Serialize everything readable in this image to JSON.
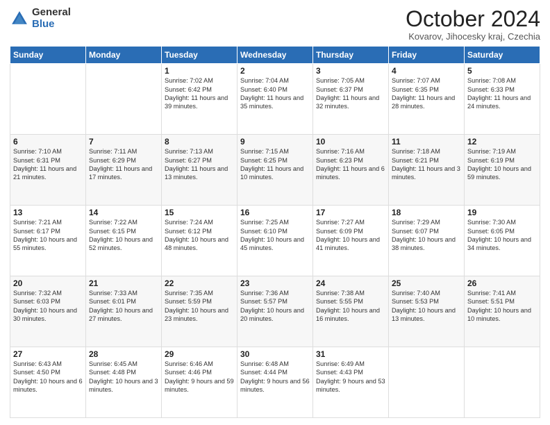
{
  "header": {
    "logo_general": "General",
    "logo_blue": "Blue",
    "month_title": "October 2024",
    "location": "Kovarov, Jihocesky kraj, Czechia"
  },
  "days_of_week": [
    "Sunday",
    "Monday",
    "Tuesday",
    "Wednesday",
    "Thursday",
    "Friday",
    "Saturday"
  ],
  "weeks": [
    [
      {
        "day": "",
        "text": ""
      },
      {
        "day": "",
        "text": ""
      },
      {
        "day": "1",
        "text": "Sunrise: 7:02 AM\nSunset: 6:42 PM\nDaylight: 11 hours and 39 minutes."
      },
      {
        "day": "2",
        "text": "Sunrise: 7:04 AM\nSunset: 6:40 PM\nDaylight: 11 hours and 35 minutes."
      },
      {
        "day": "3",
        "text": "Sunrise: 7:05 AM\nSunset: 6:37 PM\nDaylight: 11 hours and 32 minutes."
      },
      {
        "day": "4",
        "text": "Sunrise: 7:07 AM\nSunset: 6:35 PM\nDaylight: 11 hours and 28 minutes."
      },
      {
        "day": "5",
        "text": "Sunrise: 7:08 AM\nSunset: 6:33 PM\nDaylight: 11 hours and 24 minutes."
      }
    ],
    [
      {
        "day": "6",
        "text": "Sunrise: 7:10 AM\nSunset: 6:31 PM\nDaylight: 11 hours and 21 minutes."
      },
      {
        "day": "7",
        "text": "Sunrise: 7:11 AM\nSunset: 6:29 PM\nDaylight: 11 hours and 17 minutes."
      },
      {
        "day": "8",
        "text": "Sunrise: 7:13 AM\nSunset: 6:27 PM\nDaylight: 11 hours and 13 minutes."
      },
      {
        "day": "9",
        "text": "Sunrise: 7:15 AM\nSunset: 6:25 PM\nDaylight: 11 hours and 10 minutes."
      },
      {
        "day": "10",
        "text": "Sunrise: 7:16 AM\nSunset: 6:23 PM\nDaylight: 11 hours and 6 minutes."
      },
      {
        "day": "11",
        "text": "Sunrise: 7:18 AM\nSunset: 6:21 PM\nDaylight: 11 hours and 3 minutes."
      },
      {
        "day": "12",
        "text": "Sunrise: 7:19 AM\nSunset: 6:19 PM\nDaylight: 10 hours and 59 minutes."
      }
    ],
    [
      {
        "day": "13",
        "text": "Sunrise: 7:21 AM\nSunset: 6:17 PM\nDaylight: 10 hours and 55 minutes."
      },
      {
        "day": "14",
        "text": "Sunrise: 7:22 AM\nSunset: 6:15 PM\nDaylight: 10 hours and 52 minutes."
      },
      {
        "day": "15",
        "text": "Sunrise: 7:24 AM\nSunset: 6:12 PM\nDaylight: 10 hours and 48 minutes."
      },
      {
        "day": "16",
        "text": "Sunrise: 7:25 AM\nSunset: 6:10 PM\nDaylight: 10 hours and 45 minutes."
      },
      {
        "day": "17",
        "text": "Sunrise: 7:27 AM\nSunset: 6:09 PM\nDaylight: 10 hours and 41 minutes."
      },
      {
        "day": "18",
        "text": "Sunrise: 7:29 AM\nSunset: 6:07 PM\nDaylight: 10 hours and 38 minutes."
      },
      {
        "day": "19",
        "text": "Sunrise: 7:30 AM\nSunset: 6:05 PM\nDaylight: 10 hours and 34 minutes."
      }
    ],
    [
      {
        "day": "20",
        "text": "Sunrise: 7:32 AM\nSunset: 6:03 PM\nDaylight: 10 hours and 30 minutes."
      },
      {
        "day": "21",
        "text": "Sunrise: 7:33 AM\nSunset: 6:01 PM\nDaylight: 10 hours and 27 minutes."
      },
      {
        "day": "22",
        "text": "Sunrise: 7:35 AM\nSunset: 5:59 PM\nDaylight: 10 hours and 23 minutes."
      },
      {
        "day": "23",
        "text": "Sunrise: 7:36 AM\nSunset: 5:57 PM\nDaylight: 10 hours and 20 minutes."
      },
      {
        "day": "24",
        "text": "Sunrise: 7:38 AM\nSunset: 5:55 PM\nDaylight: 10 hours and 16 minutes."
      },
      {
        "day": "25",
        "text": "Sunrise: 7:40 AM\nSunset: 5:53 PM\nDaylight: 10 hours and 13 minutes."
      },
      {
        "day": "26",
        "text": "Sunrise: 7:41 AM\nSunset: 5:51 PM\nDaylight: 10 hours and 10 minutes."
      }
    ],
    [
      {
        "day": "27",
        "text": "Sunrise: 6:43 AM\nSunset: 4:50 PM\nDaylight: 10 hours and 6 minutes."
      },
      {
        "day": "28",
        "text": "Sunrise: 6:45 AM\nSunset: 4:48 PM\nDaylight: 10 hours and 3 minutes."
      },
      {
        "day": "29",
        "text": "Sunrise: 6:46 AM\nSunset: 4:46 PM\nDaylight: 9 hours and 59 minutes."
      },
      {
        "day": "30",
        "text": "Sunrise: 6:48 AM\nSunset: 4:44 PM\nDaylight: 9 hours and 56 minutes."
      },
      {
        "day": "31",
        "text": "Sunrise: 6:49 AM\nSunset: 4:43 PM\nDaylight: 9 hours and 53 minutes."
      },
      {
        "day": "",
        "text": ""
      },
      {
        "day": "",
        "text": ""
      }
    ]
  ]
}
